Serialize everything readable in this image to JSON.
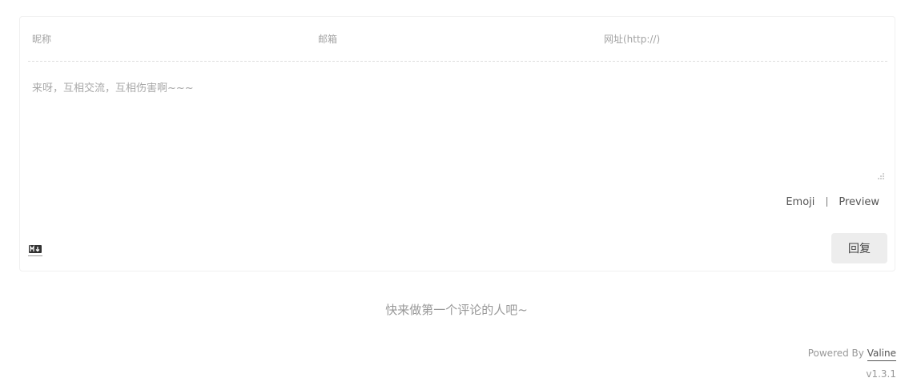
{
  "form": {
    "nick_placeholder": "昵称",
    "mail_placeholder": "邮箱",
    "link_placeholder": "网址(http://)",
    "comment_placeholder": "来呀，互相交流，互相伤害啊~~~"
  },
  "toolbar": {
    "emoji_label": "Emoji",
    "preview_label": "Preview"
  },
  "actions": {
    "submit_label": "回复"
  },
  "comments": {
    "empty_text": "快来做第一个评论的人吧~"
  },
  "footer": {
    "powered_prefix": "Powered By ",
    "powered_link": "Valine",
    "version": "v1.3.1"
  },
  "icons": {
    "markdown": "markdown-icon",
    "resize": "resize-grip-icon"
  },
  "colors": {
    "button_bg": "#ededed",
    "border": "#f0f0f0",
    "placeholder": "#a3a3a3"
  }
}
